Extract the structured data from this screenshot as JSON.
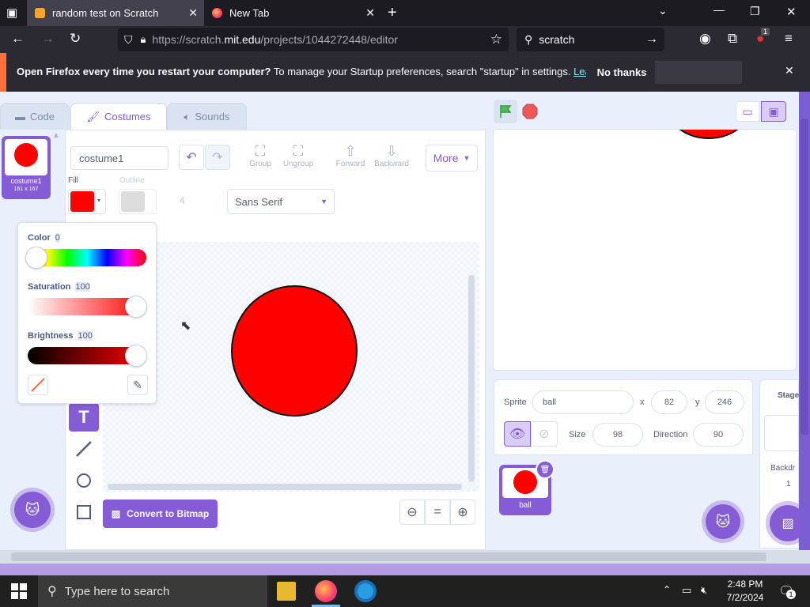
{
  "browser": {
    "tabs": [
      {
        "title": "random test on Scratch",
        "active": true
      },
      {
        "title": "New Tab",
        "active": false
      }
    ],
    "url_prefix": "https://scratch.",
    "url_domain": "mit.edu",
    "url_path": "/projects/1044272448/editor",
    "search_text": "scratch",
    "extension_badge": "1"
  },
  "notification": {
    "bold": "Open Firefox every time you restart your computer?",
    "text": " To manage your Startup preferences, search \"startup\" in settings.",
    "link": "Learn more",
    "no_thanks": "No thanks"
  },
  "editor": {
    "tabs": {
      "code": "Code",
      "costumes": "Costumes",
      "sounds": "Sounds"
    },
    "costume": {
      "index": "1",
      "name": "costume1",
      "size": "161 x 167"
    },
    "costume_name_value": "costume1",
    "toolbar": {
      "group": "Group",
      "ungroup": "Ungroup",
      "forward": "Forward",
      "backward": "Backward",
      "more": "More"
    },
    "fill_label": "Fill",
    "outline_label": "Outline",
    "outline_width": "4",
    "font": "Sans Serif",
    "picker": {
      "color_label": "Color",
      "color_value": "0",
      "saturation_label": "Saturation",
      "saturation_value": "100",
      "brightness_label": "Brightness",
      "brightness_value": "100"
    },
    "convert_button": "Convert to Bitmap",
    "zoom_reset": "="
  },
  "sprite": {
    "sprite_label": "Sprite",
    "name": "ball",
    "x_label": "x",
    "x": "82",
    "y_label": "y",
    "y": "246",
    "size_label": "Size",
    "size": "98",
    "direction_label": "Direction",
    "direction": "90",
    "thumb_name": "ball"
  },
  "stage_panel": {
    "title": "Stage",
    "backdrops_label": "Backdr",
    "backdrops_count": "1"
  },
  "taskbar": {
    "search_placeholder": "Type here to search",
    "time": "2:48 PM",
    "date": "7/2/2024",
    "notif_count": "1"
  },
  "colors": {
    "accent": "#855cd6",
    "fill": "#ff0000",
    "green_flag": "#4cbf56",
    "stop": "#ec5959"
  }
}
